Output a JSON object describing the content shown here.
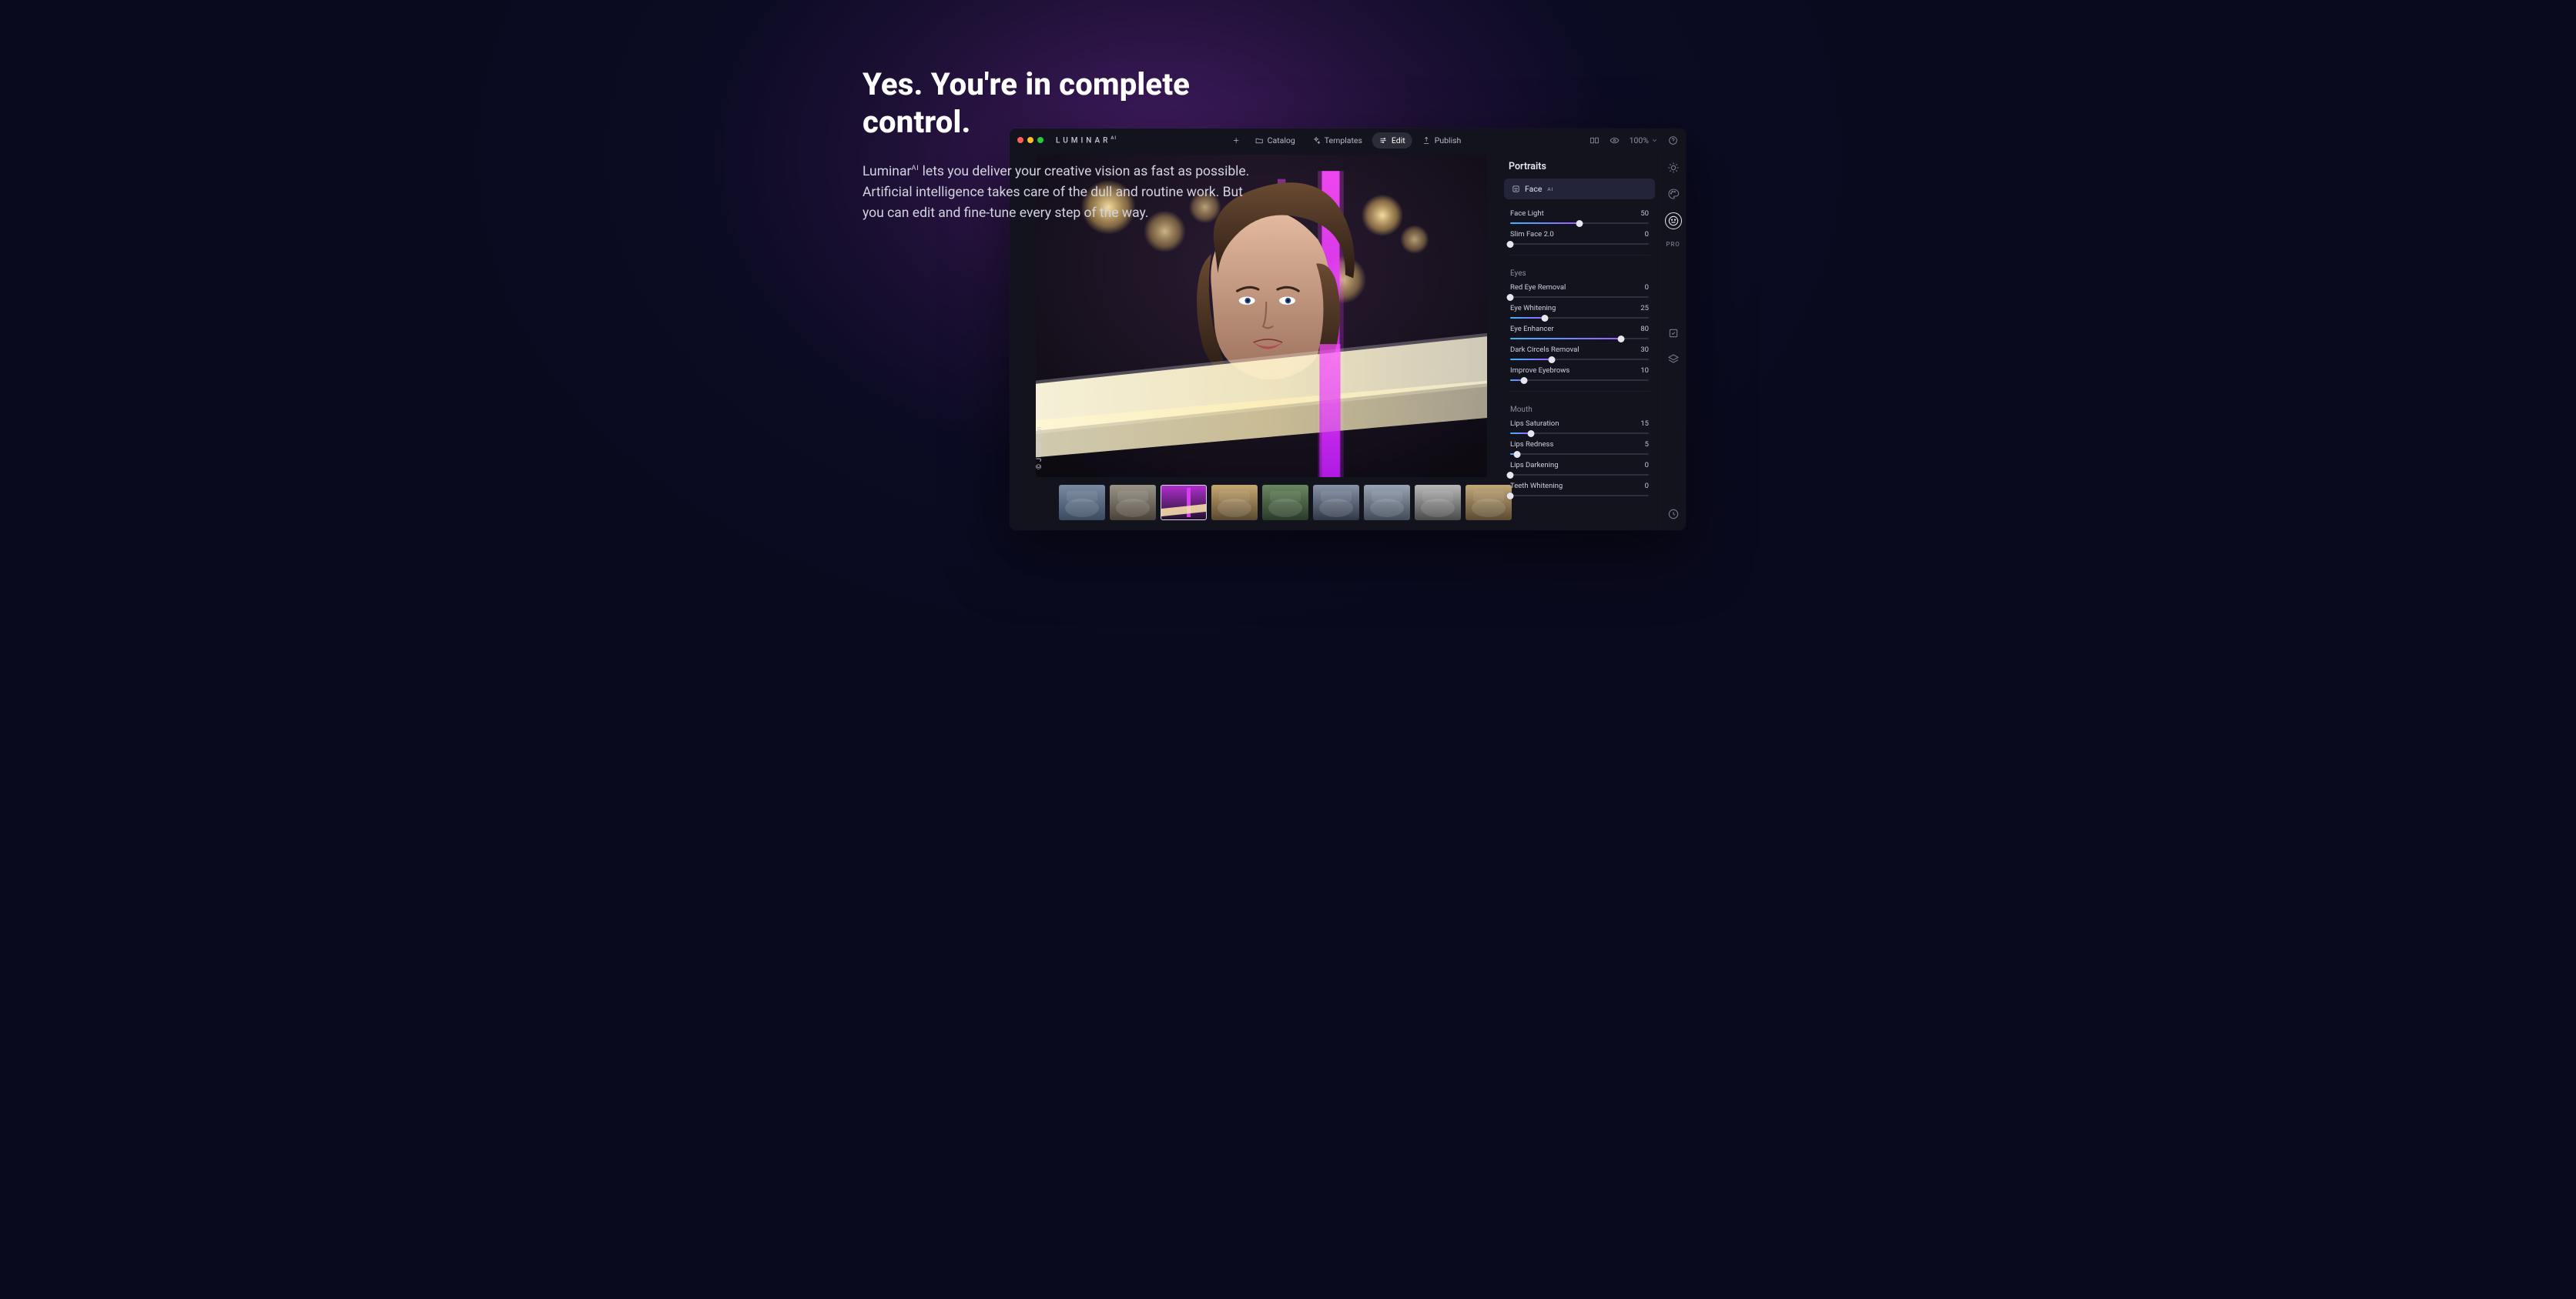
{
  "hero": {
    "title": "Yes. You're in complete control.",
    "body_prefix": "Luminar",
    "body_sup": "AI",
    "body_rest": " lets you deliver your creative vision as fast as possible. Artificial intelligence takes care of the dull and routine work. But you can edit and fine-tune every step of the way."
  },
  "app": {
    "brand": "LUMINAR",
    "brand_sup": "AI",
    "nav": {
      "catalog": "Catalog",
      "templates": "Templates",
      "edit": "Edit",
      "publish": "Publish"
    },
    "zoom": "100%",
    "credit": "© Justin Lim",
    "thumb_count": 9,
    "thumb_selected_index": 2
  },
  "panel": {
    "title": "Portraits",
    "tool_label": "Face",
    "tool_sup": "AI",
    "groups": [
      {
        "label": null,
        "sliders": [
          {
            "name": "Face Light",
            "value": 50,
            "max": 100
          },
          {
            "name": "Slim Face 2.0",
            "value": 0,
            "max": 100
          }
        ]
      },
      {
        "label": "Eyes",
        "sliders": [
          {
            "name": "Red Eye Removal",
            "value": 0,
            "max": 100
          },
          {
            "name": "Eye Whitening",
            "value": 25,
            "max": 100
          },
          {
            "name": "Eye Enhancer",
            "value": 80,
            "max": 100
          },
          {
            "name": "Dark Circels Removal",
            "value": 30,
            "max": 100
          },
          {
            "name": "Improve Eyebrows",
            "value": 10,
            "max": 100
          }
        ]
      },
      {
        "label": "Mouth",
        "sliders": [
          {
            "name": "Lips Saturation",
            "value": 15,
            "max": 100
          },
          {
            "name": "Lips Redness",
            "value": 5,
            "max": 100
          },
          {
            "name": "Lips Darkening",
            "value": 0,
            "max": 100
          },
          {
            "name": "Teeth Whitening",
            "value": 0,
            "max": 100
          }
        ]
      }
    ]
  },
  "rail": {
    "pro": "PRO"
  }
}
